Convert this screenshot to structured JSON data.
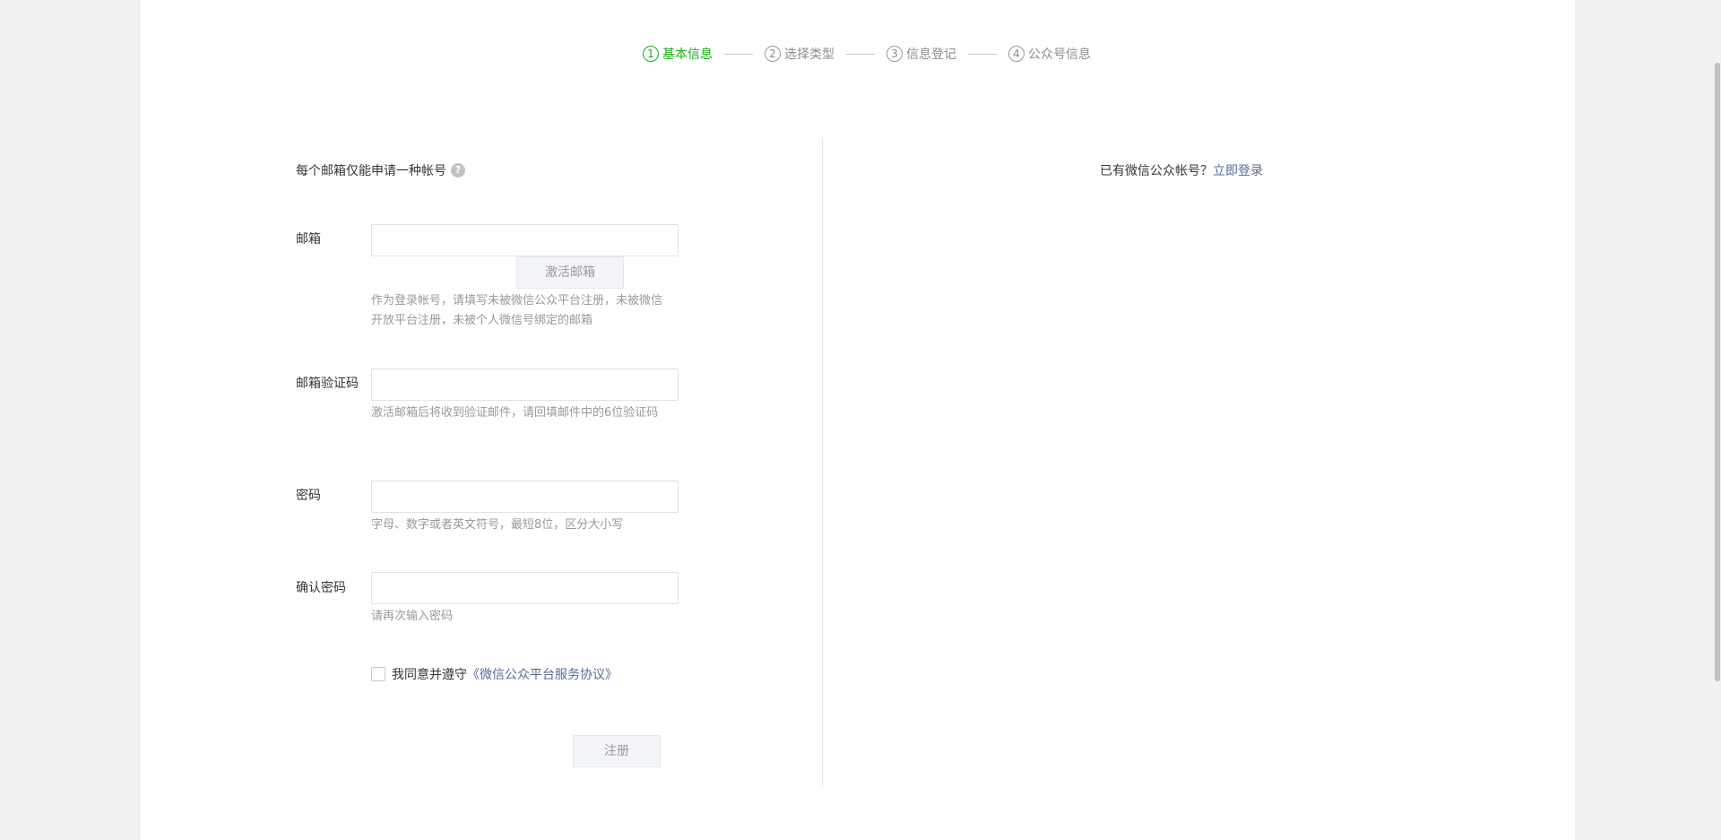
{
  "steps": [
    {
      "num": "1",
      "label": "基本信息"
    },
    {
      "num": "2",
      "label": "选择类型"
    },
    {
      "num": "3",
      "label": "信息登记"
    },
    {
      "num": "4",
      "label": "公众号信息"
    }
  ],
  "form": {
    "tip": "每个邮箱仅能申请一种帐号",
    "help_icon": "?",
    "email": {
      "label": "邮箱",
      "value": "",
      "activate_button": "激活邮箱",
      "hint": "作为登录帐号，请填写未被微信公众平台注册，未被微信开放平台注册，未被个人微信号绑定的邮箱"
    },
    "code": {
      "label": "邮箱验证码",
      "value": "",
      "hint": "激活邮箱后将收到验证邮件，请回填邮件中的6位验证码"
    },
    "password": {
      "label": "密码",
      "value": "",
      "hint": "字母、数字或者英文符号，最短8位，区分大小写"
    },
    "confirm": {
      "label": "确认密码",
      "value": "",
      "hint": "请再次输入密码"
    },
    "agree": {
      "text": "我同意并遵守",
      "link": "《微信公众平台服务协议》",
      "checked": false
    },
    "submit_button": "注册"
  },
  "login": {
    "text": "已有微信公众帐号？",
    "link": "立即登录"
  },
  "colors": {
    "active_step": "#1aad19",
    "link": "#576b95",
    "hint": "#9a9a9a"
  }
}
